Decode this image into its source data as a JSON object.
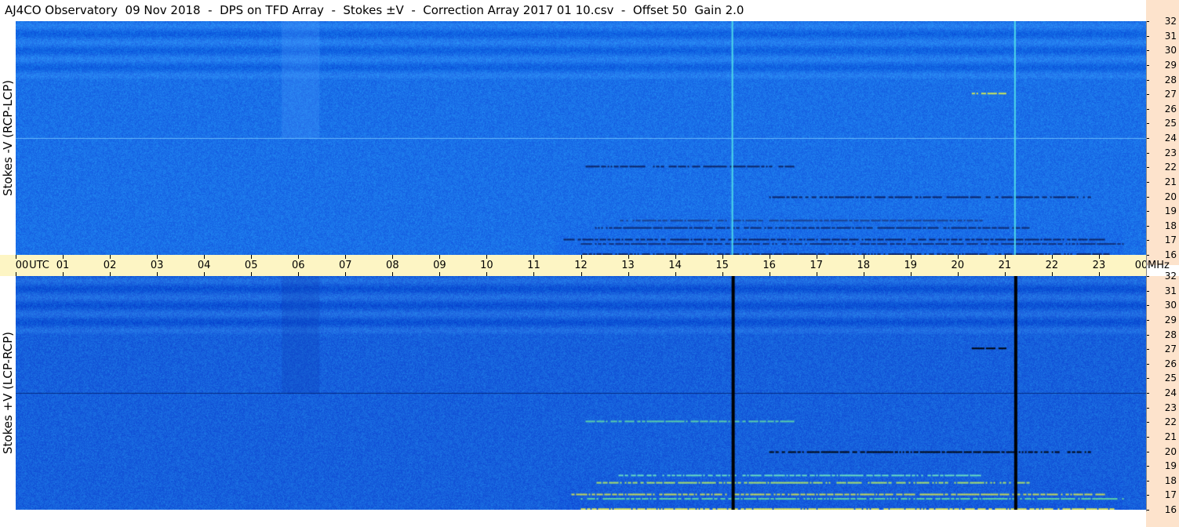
{
  "title": "AJ4CO Observatory  09 Nov 2018  -  DPS on TFD Array  -  Stokes ±V  -  Correction Array 2017 01 10.csv  -  Offset 50  Gain 2.0",
  "colors": {
    "background_blue": "#1a6ee8",
    "band_light": "#2b8cf5",
    "band_dark": "#1350c8",
    "time_axis_bg": "#fdf5c4",
    "freq_axis_bg": "#fde3cc",
    "event_line_top": "#4dd8e8",
    "event_line_bottom": "#000000"
  },
  "chart_data": [
    {
      "type": "heatmap",
      "name_label": "Stokes -V (RCP-LCP)",
      "x_axis": {
        "label": "UTC",
        "ticks": [
          "00",
          "01",
          "02",
          "03",
          "04",
          "05",
          "06",
          "07",
          "08",
          "09",
          "10",
          "11",
          "12",
          "13",
          "14",
          "15",
          "16",
          "17",
          "18",
          "19",
          "20",
          "21",
          "22",
          "23",
          "00"
        ],
        "range": [
          0,
          24
        ]
      },
      "y_axis": {
        "label": "MHz",
        "ticks": [
          "16",
          "17",
          "18",
          "19",
          "20",
          "21",
          "22",
          "23",
          "24",
          "25",
          "26",
          "27",
          "28",
          "29",
          "30",
          "31",
          "32"
        ],
        "range": [
          16,
          32
        ]
      },
      "event_lines_utc": [
        15.2,
        21.2
      ],
      "event_line_color": "#4dd8e8"
    },
    {
      "type": "heatmap",
      "name_label": "Stokes +V (LCP-RCP)",
      "x_axis": {
        "label": "UTC",
        "ticks": [
          "00",
          "01",
          "02",
          "03",
          "04",
          "05",
          "06",
          "07",
          "08",
          "09",
          "10",
          "11",
          "12",
          "13",
          "14",
          "15",
          "16",
          "17",
          "18",
          "19",
          "20",
          "21",
          "22",
          "23",
          "00"
        ],
        "range": [
          0,
          24
        ]
      },
      "y_axis": {
        "label": "MHz",
        "ticks": [
          "16",
          "17",
          "18",
          "19",
          "20",
          "21",
          "22",
          "23",
          "24",
          "25",
          "26",
          "27",
          "28",
          "29",
          "30",
          "31",
          "32"
        ],
        "range": [
          16,
          32
        ]
      },
      "event_lines_utc": [
        15.2,
        21.2
      ],
      "event_line_color": "#000000"
    }
  ],
  "time_axis": {
    "utc_label": "UTC",
    "mhz_label": "MHz"
  }
}
